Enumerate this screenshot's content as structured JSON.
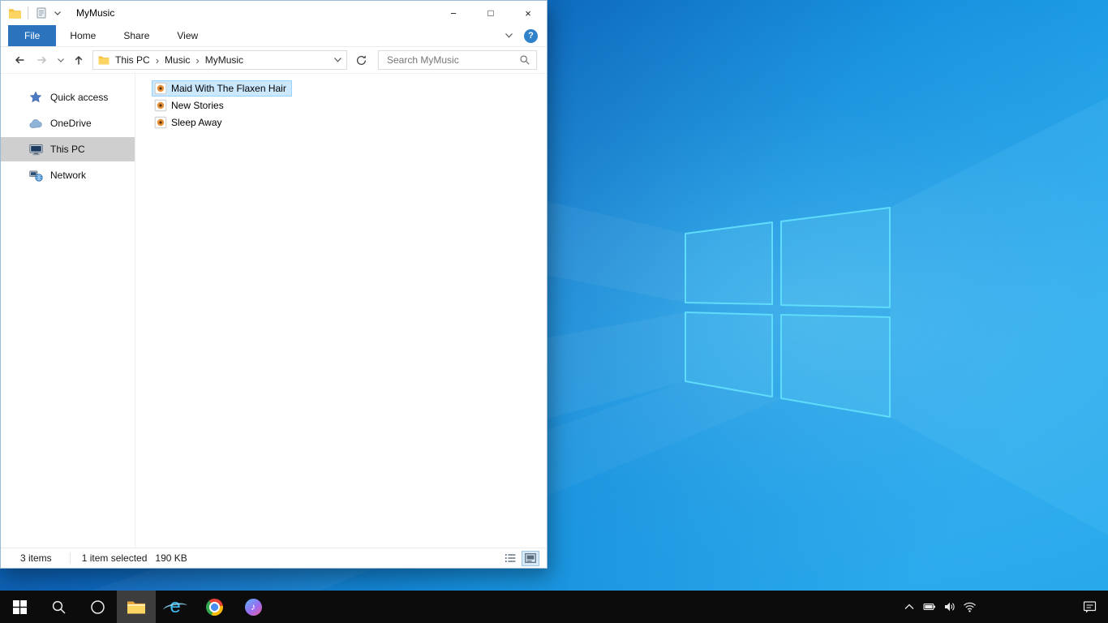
{
  "explorer": {
    "title": "MyMusic",
    "titlebar": {
      "minimize": "−",
      "maximize": "□",
      "close": "×"
    },
    "ribbon": {
      "file_tab": "File",
      "tabs": [
        {
          "label": "Home"
        },
        {
          "label": "Share"
        },
        {
          "label": "View"
        }
      ],
      "help": "?"
    },
    "address": {
      "segments": [
        {
          "label": "This PC"
        },
        {
          "label": "Music"
        },
        {
          "label": "MyMusic"
        }
      ],
      "separator": "›"
    },
    "search_placeholder": "Search MyMusic",
    "sidebar": [
      {
        "label": "Quick access"
      },
      {
        "label": "OneDrive"
      },
      {
        "label": "This PC"
      },
      {
        "label": "Network"
      }
    ],
    "files": [
      {
        "name": "Maid With The Flaxen Hair"
      },
      {
        "name": "New Stories"
      },
      {
        "name": "Sleep Away"
      }
    ],
    "status": {
      "items": "3 items",
      "selected": "1 item selected",
      "size": "190 KB"
    }
  },
  "taskbar": {
    "ie_glyph": "e",
    "itunes_note": "♪"
  },
  "colors": {
    "file_tab_blue": "#2b74bd",
    "selection_bg": "#cce8ff",
    "selection_border": "#99d1ff",
    "sidebar_selected": "#cfcfcf",
    "taskbar_black": "#0c0c0c",
    "desktop_blue": "#1590dd",
    "logo_cyan": "#5fdcf9",
    "folder_yellow": "#f7c13d"
  }
}
